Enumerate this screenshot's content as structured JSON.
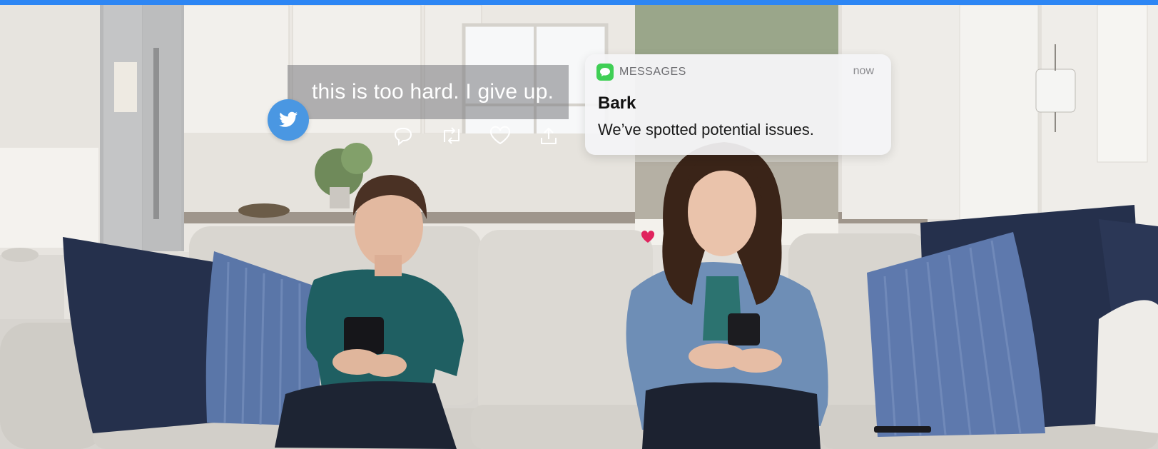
{
  "tweet": {
    "text": "this is too hard. I give up.",
    "platform_icon": "twitter-bird-icon",
    "actions": [
      "reply-icon",
      "retweet-icon",
      "like-icon",
      "share-icon"
    ]
  },
  "notification": {
    "app_icon": "messages-icon",
    "app_name": "MESSAGES",
    "time": "now",
    "title": "Bark",
    "body": "We’ve spotted potential issues."
  },
  "colors": {
    "top_bar": "#2d86f4",
    "twitter_blue": "#4a97e2",
    "messages_green": "#3fcf55",
    "like_heart": "#e0245e"
  }
}
